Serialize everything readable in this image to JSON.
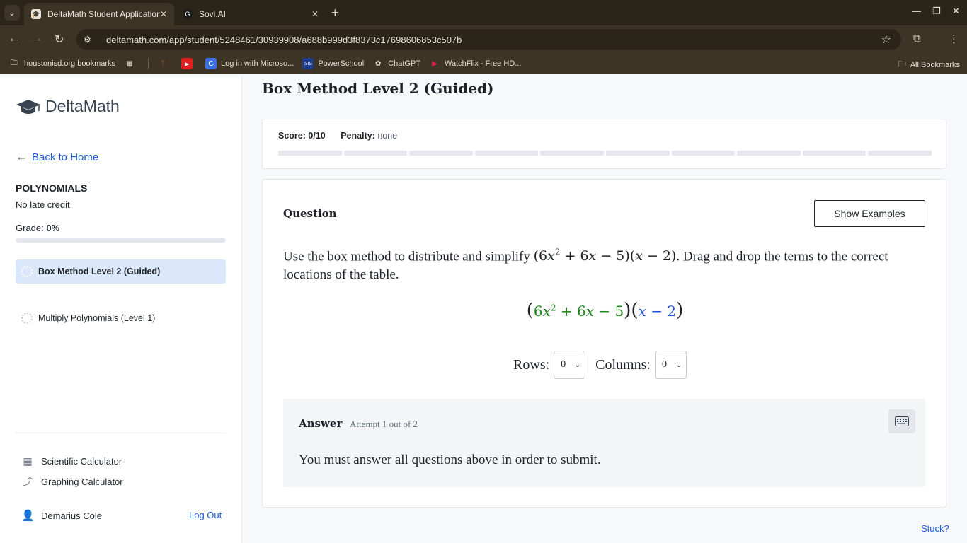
{
  "browser": {
    "tabs": [
      {
        "title": "DeltaMath Student Application",
        "active": true,
        "icon": "graduation-cap-icon"
      },
      {
        "title": "Sovi.AI",
        "active": false,
        "icon": "sovi-icon"
      }
    ],
    "url": "deltamath.com/app/student/5248461/30939908/a688b999d3f8373c17698606853c507b",
    "bookmarks": [
      {
        "label": "houstonisd.org bookmarks",
        "icon": "folder-icon"
      },
      {
        "label": "",
        "icon": "apps-grid-icon"
      },
      {
        "label": "",
        "icon": "deer-icon"
      },
      {
        "label": "",
        "icon": "youtube-icon"
      },
      {
        "label": "Log in with Microso...",
        "icon": "c-icon"
      },
      {
        "label": "PowerSchool",
        "icon": "sis-icon"
      },
      {
        "label": "ChatGPT",
        "icon": "openai-icon"
      },
      {
        "label": "WatchFlix - Free HD...",
        "icon": "play-icon"
      }
    ],
    "all_bookmarks": "All Bookmarks",
    "colors": {
      "chrome_dark": "#2b2418",
      "chrome": "#3e3425"
    }
  },
  "sidebar": {
    "brand": "DeltaMath",
    "back_label": "Back to Home",
    "assignment_title": "POLYNOMIALS",
    "late_credit": "No late credit",
    "grade_label": "Grade:",
    "grade_value": "0%",
    "grade_fraction": 0,
    "problems": [
      {
        "label": "Box Method Level 2 (Guided)",
        "active": true
      },
      {
        "label": "Multiply Polynomials (Level 1)",
        "active": false
      }
    ],
    "tools": [
      {
        "label": "Scientific Calculator",
        "icon": "calculator-icon"
      },
      {
        "label": "Graphing Calculator",
        "icon": "graph-icon"
      }
    ],
    "user_name": "Demarius Cole",
    "logout_label": "Log Out"
  },
  "main": {
    "title": "Box Method Level 2 (Guided)",
    "score_label": "Score:",
    "score_value": "0/10",
    "penalty_label": "Penalty:",
    "penalty_value": "none",
    "progress_segments": 10,
    "question_label": "Question",
    "show_examples": "Show Examples",
    "question_text_before": "Use the box method to distribute and simplify",
    "question_text_after": ". Drag and drop the terms to the correct locations of the table.",
    "expression": "(6x² + 6x − 5)(x − 2)",
    "rows_label": "Rows:",
    "rows_value": "0",
    "columns_label": "Columns:",
    "columns_value": "0",
    "answer_label": "Answer",
    "attempt_text": "Attempt 1 out of 2",
    "answer_message": "You must answer all questions above in order to submit.",
    "stuck_label": "Stuck?",
    "colors": {
      "first_factor": "#1f8b1f",
      "second_factor": "#1e4fd8",
      "link": "#1c5bd8"
    }
  }
}
